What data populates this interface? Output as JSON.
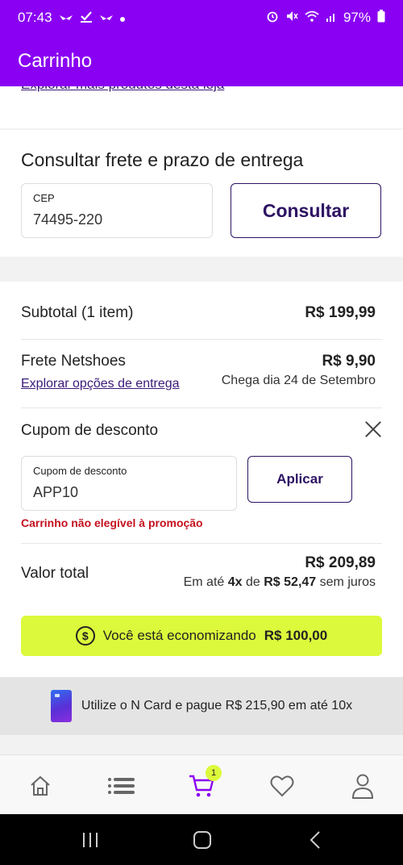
{
  "status_bar": {
    "time": "07:43",
    "left_icons": [
      "notification-icon",
      "notification-icon",
      "check-icon",
      "notification-icon",
      "dot-icon"
    ],
    "battery": "97%"
  },
  "app_bar": {
    "title": "Carrinho"
  },
  "top_link": {
    "label": "Explorar mais produtos desta loja"
  },
  "freight": {
    "title": "Consultar frete e prazo de entrega",
    "cep_label": "CEP",
    "cep_value": "74495-220",
    "consult_label": "Consultar"
  },
  "summary": {
    "subtotal_label": "Subtotal (1 item)",
    "subtotal_value": "R$ 199,99",
    "shipping_label": "Frete Netshoes",
    "shipping_value": "R$ 9,90",
    "shipping_link": "Explorar opções de entrega",
    "shipping_date": "Chega dia 24 de Setembro",
    "coupon_title": "Cupom de desconto",
    "coupon_field_label": "Cupom de desconto",
    "coupon_value": "APP10",
    "apply_label": "Aplicar",
    "coupon_error": "Carrinho não elegível à promoção",
    "total_label": "Valor total",
    "total_value": "R$ 209,89",
    "installments_prefix": "Em até",
    "installments_count": "4x",
    "installments_mid": "de",
    "installments_value": "R$ 52,47",
    "installments_suffix": "sem juros",
    "savings_text": "Você está economizando",
    "savings_value": "R$ 100,00"
  },
  "ncard_banner": {
    "text": "Utilize o N Card e pague R$ 215,90 em até 10x"
  },
  "bottom_nav": {
    "items": [
      "home-icon",
      "menu-icon",
      "cart-icon",
      "heart-icon",
      "profile-icon"
    ],
    "cart_badge": "1"
  },
  "colors": {
    "brand_purple": "#8a00f2",
    "accent_lime": "#dcf93b",
    "error_red": "#c4101f",
    "button_dark": "#2d1363"
  }
}
